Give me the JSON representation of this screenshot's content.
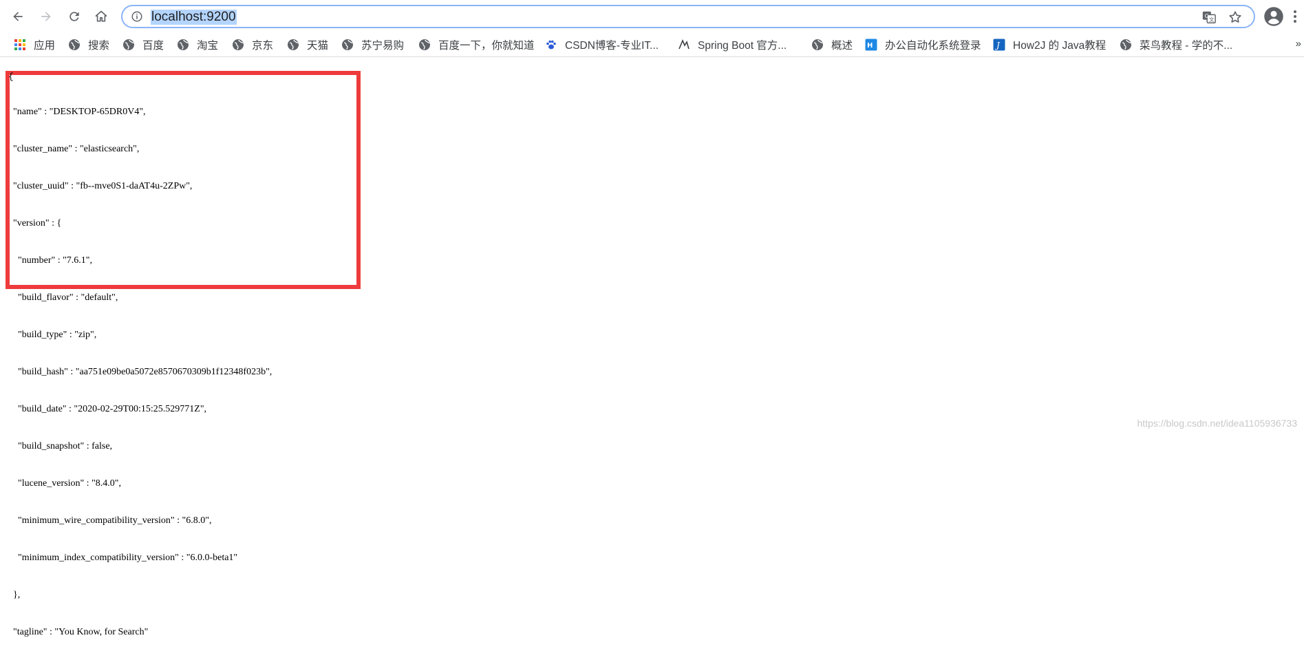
{
  "browser": {
    "url": "localhost:9200",
    "colors": {
      "accent": "#8ab4f8",
      "selection": "#b3d4fc",
      "highlight_box": "#ee3b3b"
    }
  },
  "bookmarks": [
    {
      "label": "应用",
      "icon": "apps-grid-icon"
    },
    {
      "label": "搜索",
      "icon": "globe-icon"
    },
    {
      "label": "百度",
      "icon": "globe-icon"
    },
    {
      "label": "淘宝",
      "icon": "globe-icon"
    },
    {
      "label": "京东",
      "icon": "globe-icon"
    },
    {
      "label": "天猫",
      "icon": "globe-icon"
    },
    {
      "label": "苏宁易购",
      "icon": "globe-icon"
    },
    {
      "label": "百度一下，你就知道",
      "icon": "globe-icon"
    },
    {
      "label": "CSDN博客-专业IT...",
      "icon": "paw-icon"
    },
    {
      "label": "Spring Boot 官方...",
      "icon": "spring-icon"
    },
    {
      "label": "概述",
      "icon": "globe-icon"
    },
    {
      "label": "办公自动化系统登录",
      "icon": "office-icon"
    },
    {
      "label": "How2J 的 Java教程",
      "icon": "how2j-icon"
    },
    {
      "label": "菜鸟教程 - 学的不...",
      "icon": "globe-icon"
    }
  ],
  "bookmarks_overflow": "»",
  "json": {
    "open": "{",
    "lines": [
      "  \"name\" : \"DESKTOP-65DR0V4\",",
      "  \"cluster_name\" : \"elasticsearch\",",
      "  \"cluster_uuid\" : \"fb--mve0S1-daAT4u-2ZPw\",",
      "  \"version\" : {",
      "    \"number\" : \"7.6.1\",",
      "    \"build_flavor\" : \"default\",",
      "    \"build_type\" : \"zip\",",
      "    \"build_hash\" : \"aa751e09be0a5072e8570670309b1f12348f023b\",",
      "    \"build_date\" : \"2020-02-29T00:15:25.529771Z\",",
      "    \"build_snapshot\" : false,",
      "    \"lucene_version\" : \"8.4.0\",",
      "    \"minimum_wire_compatibility_version\" : \"6.8.0\",",
      "    \"minimum_index_compatibility_version\" : \"6.0.0-beta1\"",
      "  },",
      "  \"tagline\" : \"You Know, for Search\""
    ]
  },
  "watermark": "https://blog.csdn.net/idea1105936733"
}
